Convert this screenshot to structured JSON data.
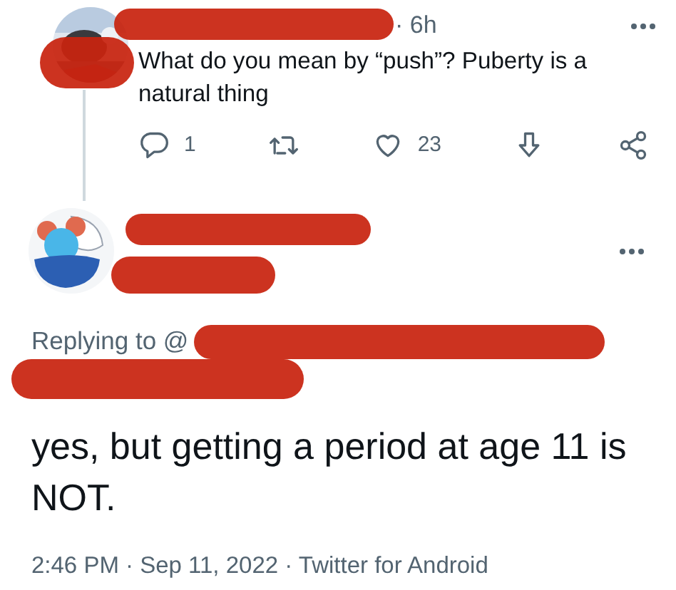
{
  "thread_tweet": {
    "time": "· 6h",
    "text": "What do you mean by “push”? Puberty is a natural thing",
    "actions": [
      {
        "kind": "reply",
        "count": "1"
      },
      {
        "kind": "retweet"
      },
      {
        "kind": "like",
        "count": "23"
      },
      {
        "kind": "save"
      },
      {
        "kind": "share"
      }
    ]
  },
  "main_tweet": {
    "replying_to": "Replying to @",
    "text": "yes, but getting a period at age 11 is NOT.",
    "footer": "2:46 PM · Sep 11, 2022 · Twitter for Android"
  }
}
